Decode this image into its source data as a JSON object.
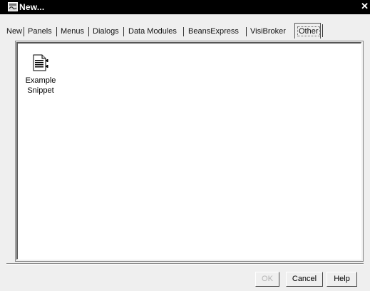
{
  "window": {
    "title": "New...",
    "close_glyph": "✕",
    "icon": "app-window-icon"
  },
  "tabs": [
    {
      "label": "New",
      "active": false
    },
    {
      "label": "Panels",
      "active": false
    },
    {
      "label": "Menus",
      "active": false
    },
    {
      "label": "Dialogs",
      "active": false
    },
    {
      "label": "Data Modules",
      "active": false
    },
    {
      "label": "BeansExpress",
      "active": false
    },
    {
      "label": "VisiBroker",
      "active": false
    },
    {
      "label": "Other",
      "active": true
    }
  ],
  "items": [
    {
      "label_line1": "Example",
      "label_line2": "Snippet",
      "icon": "snippet-document-icon"
    }
  ],
  "buttons": {
    "ok": "OK",
    "cancel": "Cancel",
    "help": "Help"
  },
  "colors": {
    "titlebar": "#000000",
    "dialog_bg": "#efefef",
    "panel_bg": "#ffffff",
    "disabled_text": "#b5b5b5"
  }
}
